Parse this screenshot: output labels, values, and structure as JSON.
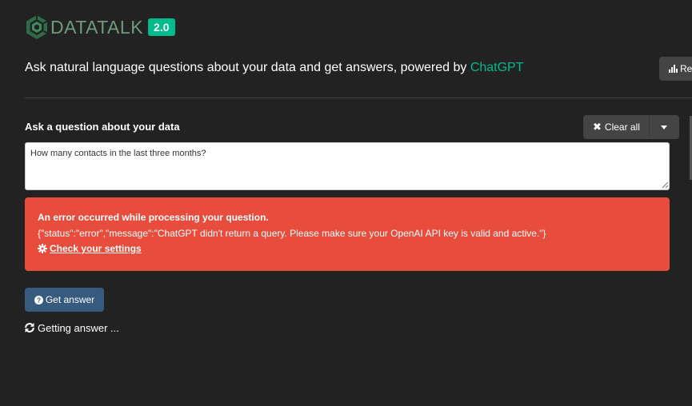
{
  "header": {
    "logo_text": "DATATALK",
    "version": "2.0",
    "tagline_prefix": "Ask natural language questions about your data and get answers, powered by ",
    "tagline_accent": "ChatGPT",
    "report_label": "Re",
    "logo_icon": "hexagon-logo-icon",
    "report_icon": "bar-chart-icon"
  },
  "question": {
    "label": "Ask a question about your data",
    "value": "How many contacts in the last three months?",
    "clear_label": "Clear all",
    "clear_icon": "x-icon",
    "dropdown_icon": "caret-down-icon"
  },
  "error": {
    "title": "An error occurred while processing your question.",
    "message": "{\"status\":\"error\",\"message\":\"ChatGPT didn't return a query. Please make sure your OpenAI API key is valid and active.\"}",
    "link_label": "Check your settings",
    "link_icon": "gear-icon"
  },
  "actions": {
    "get_answer_label": "Get answer",
    "get_answer_icon": "question-circle-icon",
    "status_text": "Getting answer ...",
    "status_icon": "refresh-icon"
  },
  "colors": {
    "background": "#222222",
    "accent": "#00bc8c",
    "error": "#e74c3c",
    "primary": "#375a7f",
    "secondary": "#444444"
  }
}
